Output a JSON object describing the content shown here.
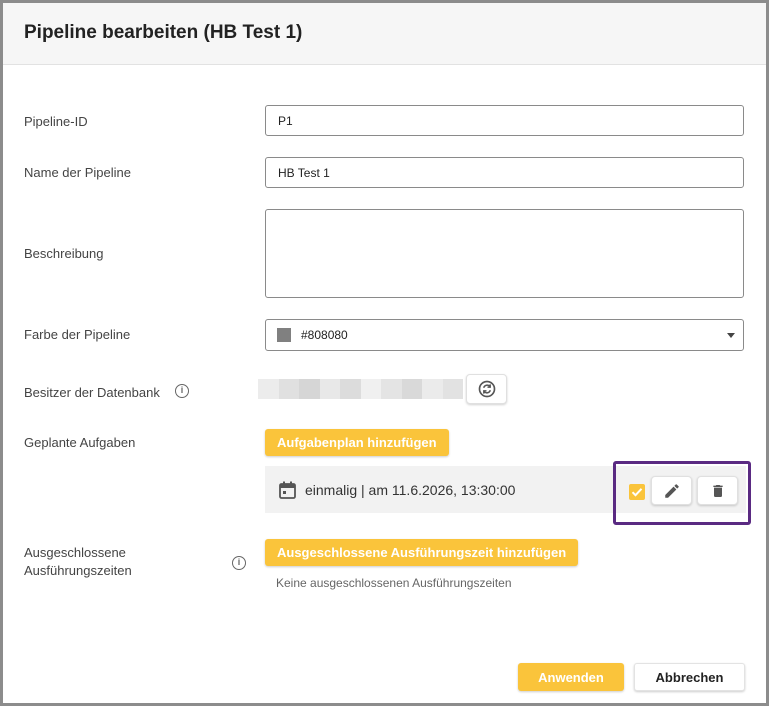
{
  "dialog": {
    "title": "Pipeline bearbeiten (HB Test 1)"
  },
  "fields": {
    "pipeline_id": {
      "label": "Pipeline-ID",
      "value": "P1"
    },
    "name": {
      "label": "Name der Pipeline",
      "value": "HB Test 1"
    },
    "description": {
      "label": "Beschreibung",
      "value": ""
    },
    "color": {
      "label": "Farbe der Pipeline",
      "value": "#808080",
      "swatch": "#808080"
    },
    "owner": {
      "label": "Besitzer der Datenbank",
      "info_icon": "info-icon",
      "refresh_icon": "refresh-icon"
    }
  },
  "scheduled_tasks": {
    "label": "Geplante Aufgaben",
    "add_button": "Aufgabenplan hinzufügen",
    "items": [
      {
        "icon": "calendar-icon",
        "text": "einmalig | am 11.6.2026, 13:30:00",
        "checked": true
      }
    ]
  },
  "excluded_times": {
    "label_line1": "Ausgeschlossene",
    "label_line2": "Ausführungszeiten",
    "info_icon": "info-icon",
    "add_button": "Ausgeschlossene Ausführungszeit hinzufügen",
    "empty_note": "Keine ausgeschlossenen Ausführungszeiten"
  },
  "footer": {
    "apply": "Anwenden",
    "cancel": "Abbrechen"
  },
  "colors": {
    "accent": "#fac43b",
    "highlight": "#5a2a82"
  }
}
